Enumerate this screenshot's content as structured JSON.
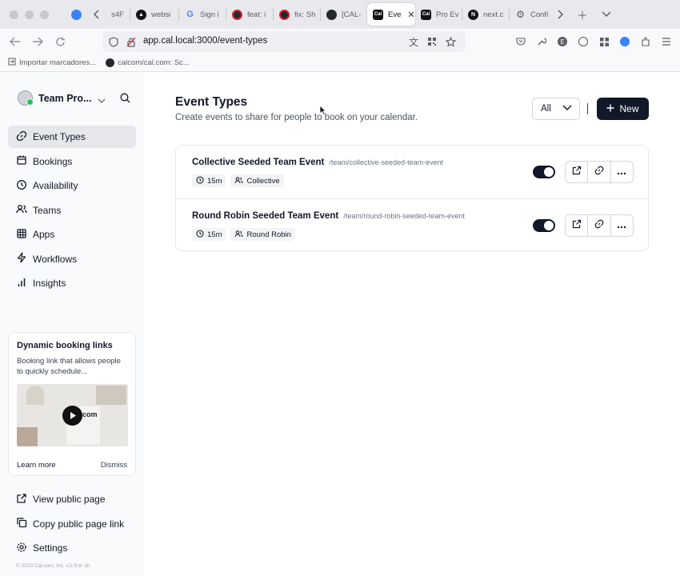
{
  "browser": {
    "tabs": [
      {
        "label": "s4F",
        "favicon": "firefox-icon",
        "color": "#3b82f6"
      },
      {
        "label": "websi",
        "favicon": "triangle-icon",
        "color": "#111111"
      },
      {
        "label": "Sign i",
        "favicon": "google-icon",
        "color": "#4285f4"
      },
      {
        "label": "feat: i",
        "favicon": "github-pr-icon",
        "color": "#d1242f"
      },
      {
        "label": "fix: Sh",
        "favicon": "github-pr-icon",
        "color": "#d1242f"
      },
      {
        "label": "[CAL-",
        "favicon": "github-icon",
        "color": "#24292f"
      },
      {
        "label": "Eve",
        "favicon": "cal-icon",
        "color": "#111111",
        "active": true
      },
      {
        "label": "Pro Ev",
        "favicon": "cal-icon",
        "color": "#111111"
      },
      {
        "label": "next.c",
        "favicon": "next-icon",
        "color": "#111111"
      },
      {
        "label": "Confi",
        "favicon": "gear-icon",
        "color": "#5b5b66"
      }
    ],
    "url": "app.cal.local:3000/event-types",
    "bookmarks": [
      {
        "label": "Importar marcadores...",
        "icon": "import-icon"
      },
      {
        "label": "calcom/cal.com: Sc...",
        "icon": "github-icon"
      }
    ]
  },
  "sidebar": {
    "team_name": "Team Pro...",
    "nav": [
      {
        "label": "Event Types",
        "icon": "link-icon",
        "active": true
      },
      {
        "label": "Bookings",
        "icon": "calendar-icon"
      },
      {
        "label": "Availability",
        "icon": "clock-icon"
      },
      {
        "label": "Teams",
        "icon": "users-icon"
      },
      {
        "label": "Apps",
        "icon": "grid-icon"
      },
      {
        "label": "Workflows",
        "icon": "zap-icon"
      },
      {
        "label": "Insights",
        "icon": "bar-chart-icon"
      }
    ],
    "promo": {
      "title": "Dynamic booking links",
      "description": "Booking link that allows people to quickly schedule...",
      "video_text": "com",
      "learn_more": "Learn more",
      "dismiss": "Dismiss"
    },
    "bottom": [
      {
        "label": "View public page",
        "icon": "external-link-icon"
      },
      {
        "label": "Copy public page link",
        "icon": "copy-icon"
      },
      {
        "label": "Settings",
        "icon": "gear-icon"
      }
    ],
    "copyright": "© 2023 Cal.com, Inc. v.2.9.8- sh"
  },
  "main": {
    "title": "Event Types",
    "subtitle": "Create events to share for people to book on your calendar.",
    "filter_label": "All",
    "new_button": "New",
    "events": [
      {
        "title": "Collective Seeded Team Event",
        "slug": "/team/collective-seeded-team-event",
        "duration": "15m",
        "type": "Collective",
        "enabled": true
      },
      {
        "title": "Round Robin Seeded Team Event",
        "slug": "/team/round-robin-seeded-team-event",
        "duration": "15m",
        "type": "Round Robin",
        "enabled": true
      }
    ]
  }
}
